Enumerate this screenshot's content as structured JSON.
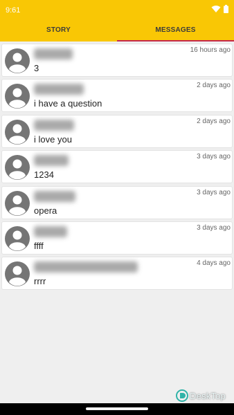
{
  "status_bar": {
    "time": "9:61",
    "icons": [
      "wifi-icon",
      "battery-icon"
    ],
    "background": "#f9c705"
  },
  "tabs": [
    {
      "label": "STORY",
      "active": false
    },
    {
      "label": "MESSAGES",
      "active": true
    }
  ],
  "accent_color": "#c6284a",
  "conversations": [
    {
      "name": "pqthgt",
      "message": "3",
      "time": "16 hours ago"
    },
    {
      "name": "muwwww",
      "message": "i have a question",
      "time": "2 days ago"
    },
    {
      "name": "swgaei",
      "message": "i love you",
      "time": "2 days ago"
    },
    {
      "name": "brnzhl",
      "message": "1234",
      "time": "3 days ago"
    },
    {
      "name": "hgyrkg",
      "message": "opera",
      "time": "3 days ago"
    },
    {
      "name": "jnswp",
      "message": "ffff",
      "time": "3 days ago"
    },
    {
      "name": "fhnsrh_wwdk_fhaeh",
      "message": "rrrr",
      "time": "4 days ago"
    }
  ],
  "watermark": {
    "text": "DeskTop"
  }
}
